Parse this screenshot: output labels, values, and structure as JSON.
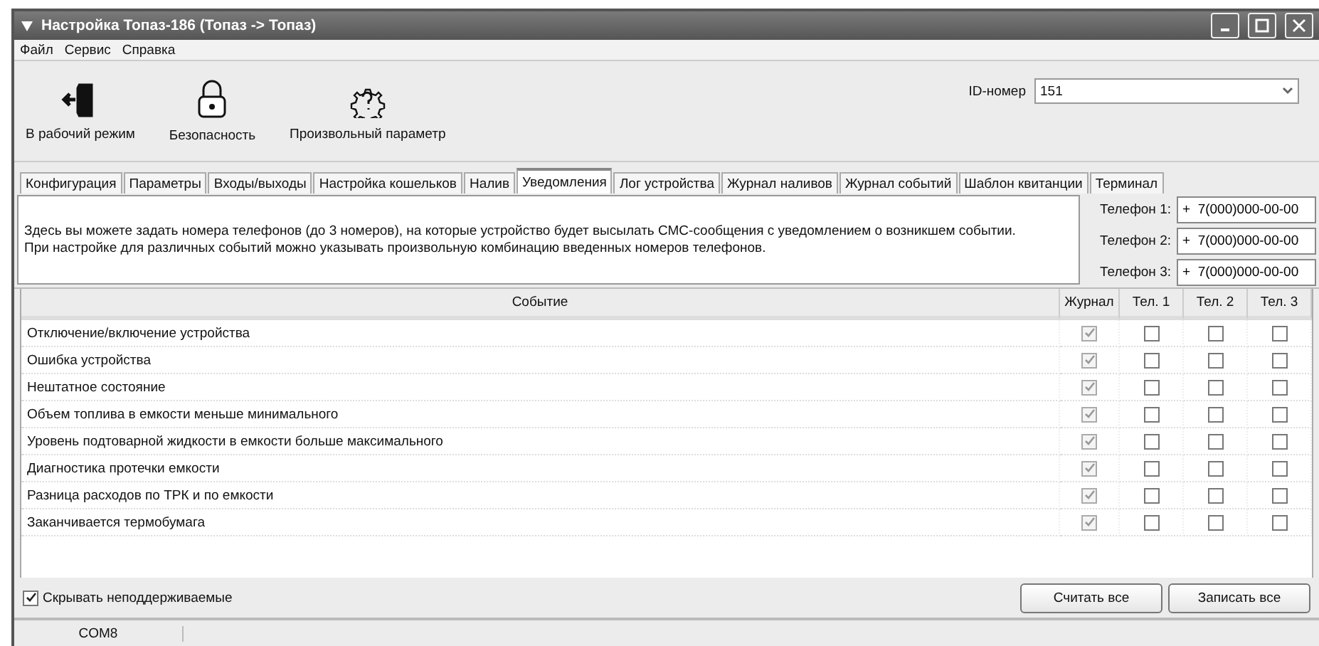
{
  "window": {
    "title": "Настройка Топаз-186 (Топаз -> Топаз)"
  },
  "menu": [
    "Файл",
    "Сервис",
    "Справка"
  ],
  "toolbar": [
    {
      "kind": "exit",
      "label": "В рабочий режим"
    },
    {
      "kind": "lock",
      "label": "Безопасность"
    },
    {
      "kind": "gear",
      "label": "Произвольный параметр"
    }
  ],
  "id_field": {
    "label": "ID-номер",
    "value": "151"
  },
  "tabs": [
    {
      "label": "Конфигурация",
      "selected": false
    },
    {
      "label": "Параметры",
      "selected": false
    },
    {
      "label": "Входы/выходы",
      "selected": false
    },
    {
      "label": "Настройка кошельков",
      "selected": false
    },
    {
      "label": "Налив",
      "selected": false
    },
    {
      "label": "Уведомления",
      "selected": true
    },
    {
      "label": "Лог устройства",
      "selected": false
    },
    {
      "label": "Журнал наливов",
      "selected": false
    },
    {
      "label": "Журнал событий",
      "selected": false
    },
    {
      "label": "Шаблон квитанции",
      "selected": false
    },
    {
      "label": "Терминал",
      "selected": false
    }
  ],
  "info": "Здесь вы можете задать номера телефонов (до 3 номеров), на которые устройство будет высылать СМС-сообщения с уведомлением о возникшем событии.\nПри настройке для различных событий можно указывать произвольную комбинацию введенных номеров телефонов.",
  "phones": [
    {
      "label": "Телефон 1:",
      "value": "+  7(000)000-00-00"
    },
    {
      "label": "Телефон 2:",
      "value": "+  7(000)000-00-00"
    },
    {
      "label": "Телефон 3:",
      "value": "+  7(000)000-00-00"
    }
  ],
  "table": {
    "columns": [
      "Событие",
      "Журнал",
      "Тел. 1",
      "Тел. 2",
      "Тел. 3"
    ],
    "rows": [
      {
        "event": "Отключение/включение устройства",
        "checks": [
          {
            "checked": true,
            "disabled": true
          },
          {
            "checked": false,
            "disabled": false
          },
          {
            "checked": false,
            "disabled": false
          },
          {
            "checked": false,
            "disabled": false
          }
        ]
      },
      {
        "event": "Ошибка устройства",
        "checks": [
          {
            "checked": true,
            "disabled": true
          },
          {
            "checked": false,
            "disabled": false
          },
          {
            "checked": false,
            "disabled": false
          },
          {
            "checked": false,
            "disabled": false
          }
        ]
      },
      {
        "event": "Нештатное состояние",
        "checks": [
          {
            "checked": true,
            "disabled": true
          },
          {
            "checked": false,
            "disabled": false
          },
          {
            "checked": false,
            "disabled": false
          },
          {
            "checked": false,
            "disabled": false
          }
        ]
      },
      {
        "event": "Объем топлива в емкости меньше минимального",
        "checks": [
          {
            "checked": true,
            "disabled": true
          },
          {
            "checked": false,
            "disabled": false
          },
          {
            "checked": false,
            "disabled": false
          },
          {
            "checked": false,
            "disabled": false
          }
        ]
      },
      {
        "event": "Уровень подтоварной жидкости в емкости больше максимального",
        "checks": [
          {
            "checked": true,
            "disabled": true
          },
          {
            "checked": false,
            "disabled": false
          },
          {
            "checked": false,
            "disabled": false
          },
          {
            "checked": false,
            "disabled": false
          }
        ]
      },
      {
        "event": "Диагностика протечки емкости",
        "checks": [
          {
            "checked": true,
            "disabled": true
          },
          {
            "checked": false,
            "disabled": false
          },
          {
            "checked": false,
            "disabled": false
          },
          {
            "checked": false,
            "disabled": false
          }
        ]
      },
      {
        "event": "Разница расходов по ТРК и по емкости",
        "checks": [
          {
            "checked": true,
            "disabled": true
          },
          {
            "checked": false,
            "disabled": false
          },
          {
            "checked": false,
            "disabled": false
          },
          {
            "checked": false,
            "disabled": false
          }
        ]
      },
      {
        "event": "Заканчивается термобумага",
        "checks": [
          {
            "checked": true,
            "disabled": true
          },
          {
            "checked": false,
            "disabled": false
          },
          {
            "checked": false,
            "disabled": false
          },
          {
            "checked": false,
            "disabled": false
          }
        ]
      }
    ]
  },
  "hide_unsupported": {
    "label": "Скрывать неподдерживаемые",
    "checked": true
  },
  "buttons": [
    "Считать все",
    "Записать все"
  ],
  "status_bar": [
    "COM8"
  ]
}
